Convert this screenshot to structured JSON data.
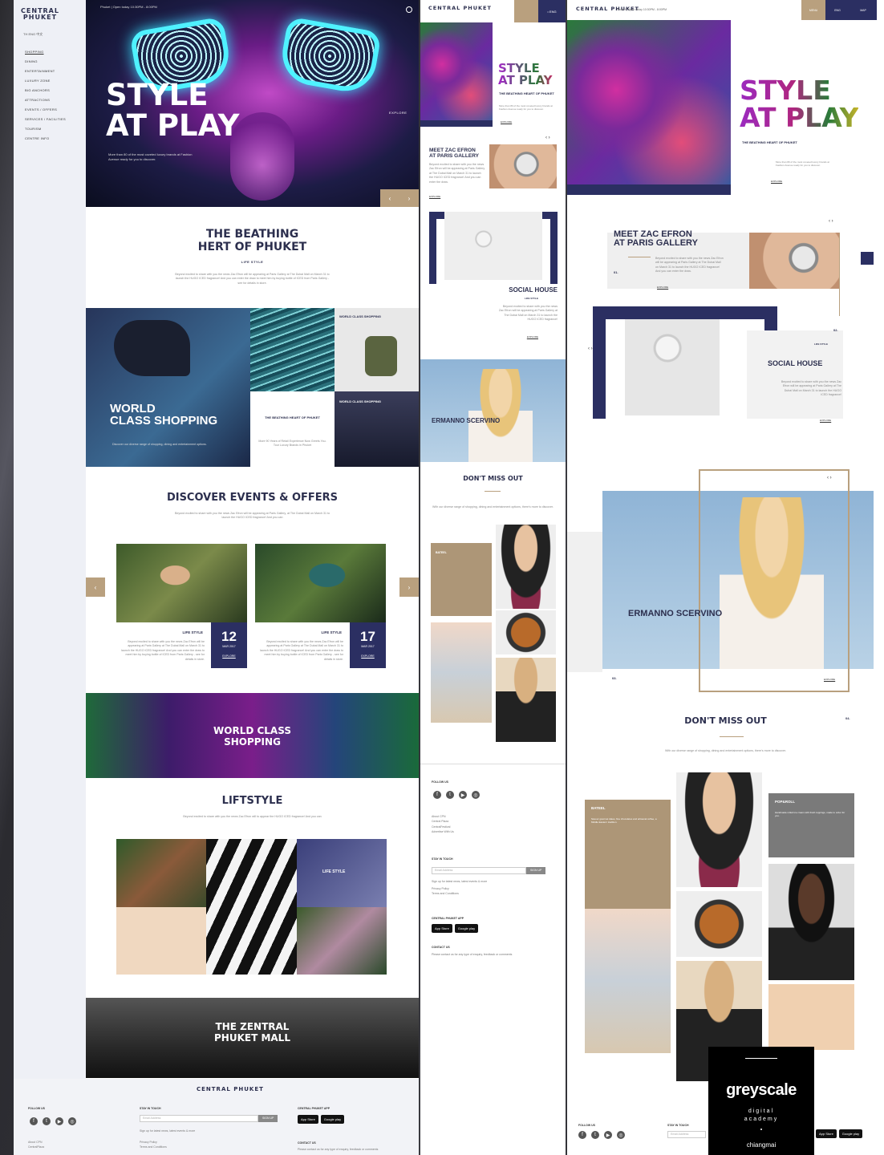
{
  "brand": {
    "logo": "CENTRAL PHUKET",
    "gold": "#b9a07e",
    "navy": "#2b2f62"
  },
  "desktop": {
    "lang": "TH  ENG  中文",
    "breadcrumb": "Phuket  |  Open today 10:30PM - 8:00PM",
    "menu": [
      "SHOPPING",
      "DINING",
      "ENTERTAINMENT",
      "LUXURY ZONE",
      "BIG ANCHORS",
      "ATTRACTIONS",
      "EVENTS / OFFERS",
      "SERVICES / FACILITIES",
      "TOURISM",
      "CENTRE INFO"
    ],
    "hero": {
      "title_line1": "STYLE",
      "title_line2": "AT PLAY",
      "subtitle": "More than 80 of the most coveted luxury brands at Fashion Avenue ready for you to discover.",
      "explore": "EXPLORE"
    },
    "heart": {
      "title_line1": "THE BEATHING",
      "title_line2": "HERT OF PHUKET",
      "category": "LIFE STYLE",
      "body": "Beyond excited to share with you the news Zac Efron will be appearing at Paris Gallery at The Dubai Mall on March 31 to launch the HUGO ICED fragrance! And you can enter the draw to meet him by buying bottle of ICED from Paris Gallery - see for details in store."
    },
    "mosaic": {
      "main_line1": "WORLD",
      "main_line2": "CLASS SHOPPING",
      "main_body": "Discover our diverse range of shopping, dining and entertainment options.",
      "tile_bag": "WORLD CLASS SHOPPING",
      "tile_heart": "THE BEATHING HEART OF PHUKET",
      "tile_heart_body": "More 90 Years of Retail Experience Now Greets You. Tour Luxury Brands in Phuket",
      "tile_dark": "WORLD CLASS SHOPPING"
    },
    "events": {
      "title": "DISCOVER EVENTS & OFFERS",
      "body": "Beyond excited to share with you the news Zac Efron will be appearing at Paris Gallery, at The Dubai Mall on March 31 to launch the HUGO ICED fragrance! And you can",
      "cards": [
        {
          "category": "LIFE STYLE",
          "day": "12",
          "month": "MAR 2017",
          "cta": "EXPLORE",
          "body": "Beyond excited to share with you the news Zac Efron will be appearing at Paris Gallery at The Dubai Mall on March 31 to launch the HUGO ICED fragrance! And you can enter the draw to meet him by buying bottle of ICED from Paris Gallery - see for details in store."
        },
        {
          "category": "LIFE STYLE",
          "day": "17",
          "month": "MAR 2017",
          "cta": "EXPLORE",
          "body": "Beyond excited to share with you the news Zac Efron will be appearing at Paris Gallery at The Dubai Mall on March 31 to launch the HUGO ICED fragrance! And you can enter the draw to meet him by buying bottle of ICED from Paris Gallery - see for details in store."
        }
      ]
    },
    "banner": {
      "line1": "WORLD CLASS",
      "line2": "SHOPPING"
    },
    "lifestyle": {
      "title": "LIFTSTYLE",
      "body": "Beyond excited to share with you the news Zac Efron will to appear the HUGO ICED fragrance! And you can",
      "tile_label": "LIFE STYLE"
    },
    "zentral": {
      "line1": "THE ZENTRAL",
      "line2": "PHUKET MALL"
    },
    "footer": {
      "follow": "FOLLOW US",
      "stay": "STAY IN TOUCH",
      "app": "CENTRAL PHUKET APP",
      "contact": "CONTACT US",
      "email_placeholder": "Email Address",
      "signup": "SIGN UP",
      "signup_note": "Sign up for latest news, latest events & more",
      "links": [
        "About CPN",
        "CentralPlaza"
      ],
      "links2": [
        "Privacy Policy",
        "Terms and Conditions"
      ],
      "contact_body": "Please contact us for any type of enquiry, feedback or comments",
      "app_store": "App Store",
      "google_play": "Google play"
    }
  },
  "mobile": {
    "lang": "• ENG",
    "hero": {
      "title_line1": "STYLE",
      "title_line2": "AT PLAY",
      "heading": "THE BEATHING HEART OF PHUKET",
      "body": "More than 80 of the most coveted luxury brands at Fashion Avenue ready for you to discover.",
      "explore": "EXPLORE"
    },
    "zac": {
      "title_line1": "MEET ZAC EFRON",
      "title_line2": "AT PARIS GALLERY",
      "body": "Beyond excited to share with you the news Zac Efron will be appearing at Paris Gallery at The Dubai Mall on March 31 to launch the HUGO ICED fragrance! And you can enter the draw.",
      "explore": "EXPLORE",
      "arrows": "‹  ›"
    },
    "social": {
      "title": "SOCIAL HOUSE",
      "category": "LIFE STYLE",
      "body": "Beyond excited to share with you the news Zac Efron will be appearing at Paris Gallery at The Dubai Mall on March 31 to launch the HUGO ICED fragrance!",
      "explore": "EXPLORE"
    },
    "ermanno": {
      "title": "ERMANNO SCERVINO"
    },
    "dmo": {
      "title": "DON'T MISS OUT",
      "body": "With our diverse range of shopping, dining and entertainment options, there's more to discover.",
      "tile_label": "BATEEL"
    },
    "footer": {
      "follow": "FOLLOW US",
      "links": [
        "About CPN",
        "Central Plaza",
        "CentralFestival",
        "Advertise With Us"
      ],
      "stay": "STAY IN TOUCH",
      "email_placeholder": "Email Address",
      "signup": "SIGN UP",
      "signup_note": "Sign up for latest news, latest events & more",
      "links2": [
        "Privacy Policy",
        "Terms and Conditions"
      ],
      "app": "CENTRAL PHUKET APP",
      "app_store": "App Store",
      "google_play": "Google play",
      "contact": "CONTACT US",
      "contact_body": "Please contact us for any type of enquiry, feedback or comments"
    }
  },
  "tablet": {
    "breadcrumb": "Phuket  |  Open today 10:30PM - 8:00PM",
    "btn1": "MENU",
    "btn2": "ENG",
    "btn3": "MAP",
    "hero": {
      "title_line1": "STYLE",
      "title_line2": "AT PLAY",
      "heading": "THE BEATHING HEART OF PHUKET",
      "body": "More than 80 of the most coveted luxury brands at Fashion Avenue ready for you to discover.",
      "explore": "EXPLORE"
    },
    "zac": {
      "title_line1": "MEET ZAC EFRON",
      "title_line2": "AT PARIS GALLERY",
      "number": "01.",
      "body": "Beyond excited to share with you the news Zac Efron will be appearing at Paris Gallery at The Dubai Mall on March 31 to launch the HUGO ICED fragrance! And you can enter the draw.",
      "explore": "EXPLORE",
      "arrows": "‹  ›"
    },
    "social": {
      "title": "SOCIAL HOUSE",
      "category": "LIFE STYLE",
      "number": "02.",
      "body": "Beyond excited to share with you the news Zac Efron will be appearing at Paris Gallery at The Dubai Mall on March 31 to launch the HUGO ICED fragrance!",
      "explore": "EXPLORE",
      "arrows": "‹  ›"
    },
    "ermanno": {
      "title": "ERMANNO SCERVINO",
      "number": "03.",
      "explore": "EXPLORE",
      "arrows": "‹  ›"
    },
    "dmo": {
      "title": "DON'T MISS OUT",
      "number": "04.",
      "body": "With our diverse range of shopping, dining and entertainment options, there's more to discover.",
      "tiles": [
        {
          "caption": "BATEEL",
          "body": "Savour gourmet dates, fine chocolates and artisanal coffee, a Middle Eastern tradition."
        },
        {
          "caption": "POP&ROLL",
          "body": "Handmade rolled ice cream with fresh toppings, made to order for you."
        }
      ]
    },
    "footer": {
      "follow": "FOLLOW US",
      "stay": "STAY IN TOUCH",
      "email_placeholder": "Email Address"
    }
  },
  "watermark": {
    "name": "greyscale",
    "line1": "digital",
    "line2": "academy",
    "city": "chiangmai"
  }
}
